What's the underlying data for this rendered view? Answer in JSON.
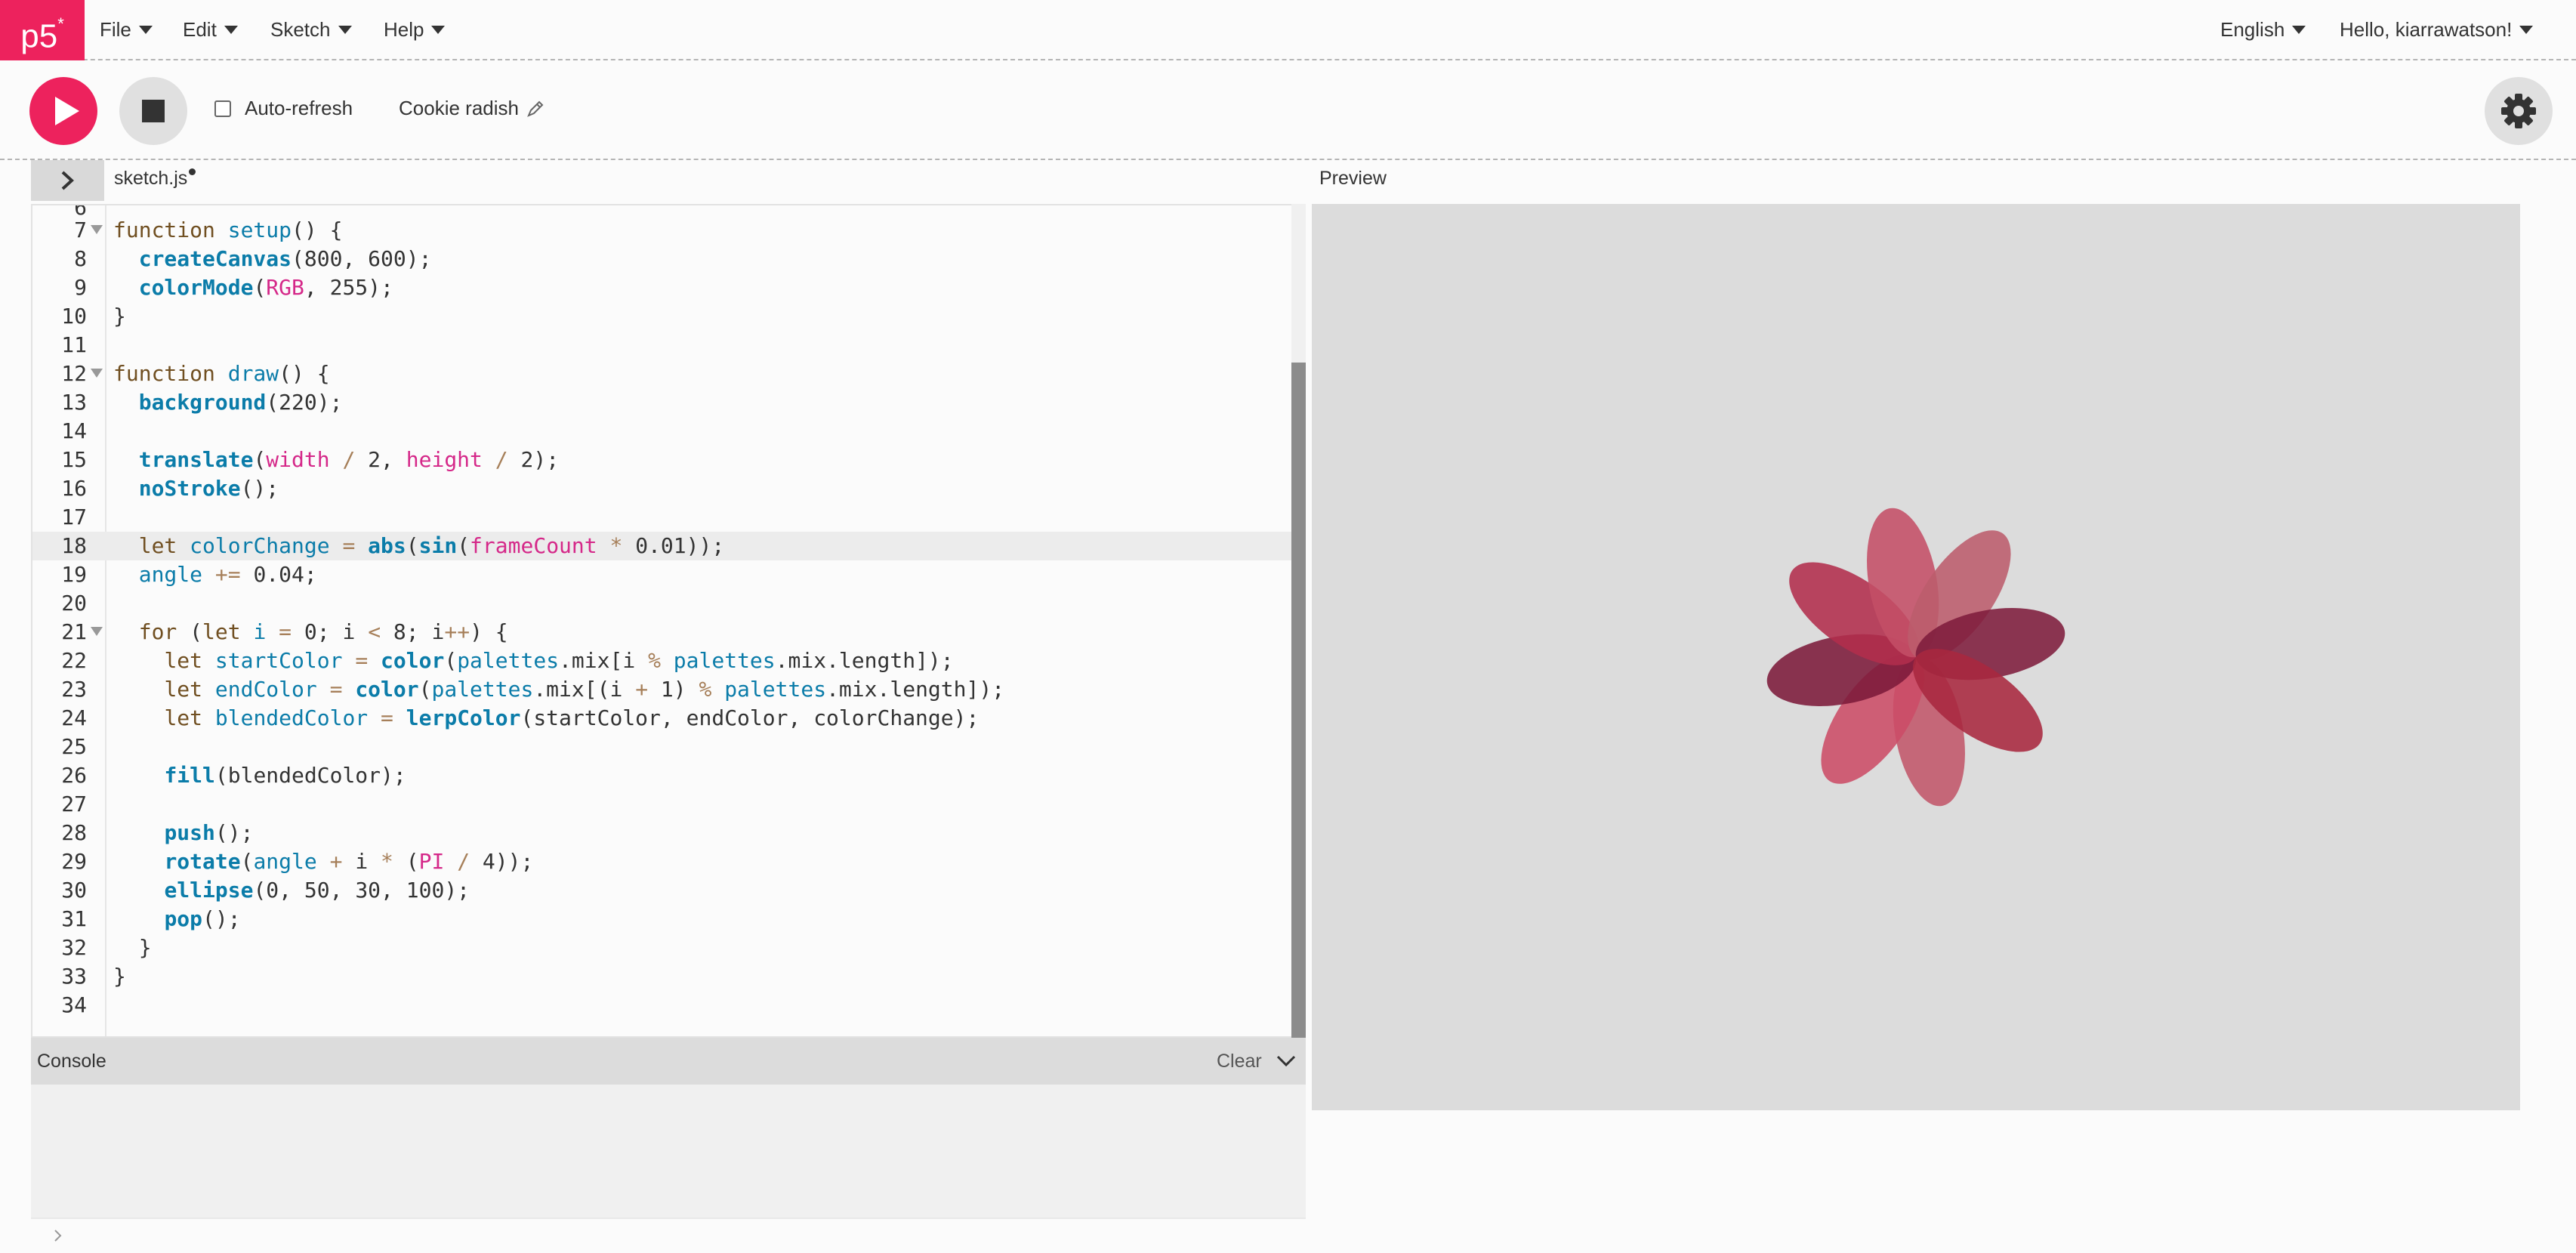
{
  "nav": {
    "logo": "p5",
    "logo_sup": "*",
    "menus": [
      "File",
      "Edit",
      "Sketch",
      "Help"
    ],
    "language": "English",
    "greeting": "Hello, kiarrawatson!"
  },
  "toolbar": {
    "autorefresh_label": "Auto-refresh",
    "autorefresh_checked": false,
    "sketch_name": "Cookie radish"
  },
  "editor": {
    "file_name": "sketch.js",
    "unsaved": true,
    "active_line": 18,
    "partial_line_number": "6",
    "lines": [
      {
        "n": "7",
        "fold": true,
        "code": "function setup() {"
      },
      {
        "n": "8",
        "code": "  createCanvas(800, 600);"
      },
      {
        "n": "9",
        "code": "  colorMode(RGB, 255);"
      },
      {
        "n": "10",
        "code": "}"
      },
      {
        "n": "11",
        "code": ""
      },
      {
        "n": "12",
        "fold": true,
        "code": "function draw() {"
      },
      {
        "n": "13",
        "code": "  background(220);"
      },
      {
        "n": "14",
        "code": ""
      },
      {
        "n": "15",
        "code": "  translate(width / 2, height / 2);"
      },
      {
        "n": "16",
        "code": "  noStroke();"
      },
      {
        "n": "17",
        "code": ""
      },
      {
        "n": "18",
        "code": "  let colorChange = abs(sin(frameCount * 0.01));"
      },
      {
        "n": "19",
        "code": "  angle += 0.04;"
      },
      {
        "n": "20",
        "code": ""
      },
      {
        "n": "21",
        "fold": true,
        "code": "  for (let i = 0; i < 8; i++) {"
      },
      {
        "n": "22",
        "code": "    let startColor = color(palettes.mix[i % palettes.mix.length]);"
      },
      {
        "n": "23",
        "code": "    let endColor = color(palettes.mix[(i + 1) % palettes.mix.length]);"
      },
      {
        "n": "24",
        "code": "    let blendedColor = lerpColor(startColor, endColor, colorChange);"
      },
      {
        "n": "25",
        "code": ""
      },
      {
        "n": "26",
        "code": "    fill(blendedColor);"
      },
      {
        "n": "27",
        "code": ""
      },
      {
        "n": "28",
        "code": "    push();"
      },
      {
        "n": "29",
        "code": "    rotate(angle + i * (PI / 4));"
      },
      {
        "n": "30",
        "code": "    ellipse(0, 50, 30, 100);"
      },
      {
        "n": "31",
        "code": "    pop();"
      },
      {
        "n": "32",
        "code": "  }"
      },
      {
        "n": "33",
        "code": "}"
      },
      {
        "n": "34",
        "code": ""
      }
    ]
  },
  "console": {
    "title": "Console",
    "clear_label": "Clear"
  },
  "preview": {
    "title": "Preview",
    "petal_colors": [
      "#c2566a",
      "#cc4c66",
      "#7c1a3a",
      "#b22d4c",
      "#c44e66",
      "#bc5c6c",
      "#7e1c3c",
      "#a8283f"
    ]
  },
  "colors": {
    "accent": "#ed225d",
    "code_keyword": "#704f21",
    "code_function": "#0b7ca9",
    "code_p5_constant": "#d52889",
    "code_operator": "#a67f59"
  }
}
